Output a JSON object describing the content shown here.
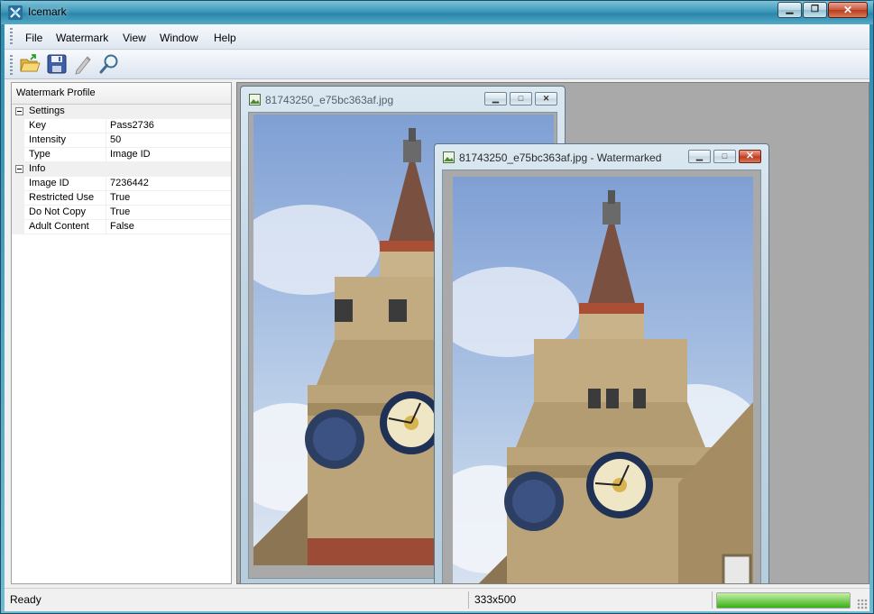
{
  "window": {
    "title": "Icemark"
  },
  "menu": [
    "File",
    "Watermark",
    "View",
    "Window",
    "Help"
  ],
  "toolbar": {
    "buttons": [
      {
        "icon": "open-folder-icon",
        "label": "Open"
      },
      {
        "icon": "save-disk-icon",
        "label": "Save"
      },
      {
        "icon": "pencil-icon",
        "label": "Edit"
      },
      {
        "icon": "magnifier-icon",
        "label": "Search"
      }
    ]
  },
  "profile": {
    "title": "Watermark Profile",
    "categories": [
      {
        "name": "Settings",
        "rows": [
          {
            "key": "Key",
            "value": "Pass2736"
          },
          {
            "key": "Intensity",
            "value": "50"
          },
          {
            "key": "Type",
            "value": "Image ID"
          }
        ]
      },
      {
        "name": "Info",
        "rows": [
          {
            "key": "Image ID",
            "value": "7236442"
          },
          {
            "key": "Restricted Use",
            "value": "True"
          },
          {
            "key": "Do Not Copy",
            "value": "True"
          },
          {
            "key": "Adult Content",
            "value": "False"
          }
        ]
      }
    ]
  },
  "documents": [
    {
      "title": "81743250_e75bc363af.jpg",
      "active": false
    },
    {
      "title": "81743250_e75bc363af.jpg - Watermarked",
      "active": true
    }
  ],
  "status": {
    "text": "Ready",
    "dimensions": "333x500",
    "progress": 1.0
  },
  "colors": {
    "accent": "#2a86a9",
    "sky": "#86a4d6",
    "stone": "#b9a27a",
    "brick": "#9c4b36"
  }
}
